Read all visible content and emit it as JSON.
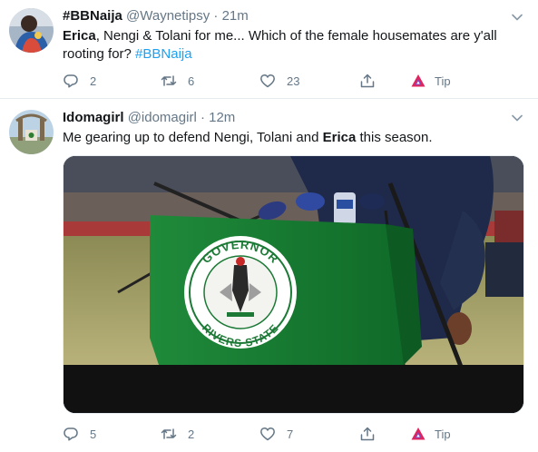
{
  "tweets": [
    {
      "display_name": "#BBNaija",
      "handle": "@Waynetipsy",
      "separator": "·",
      "time": "21m",
      "text_parts": [
        "Erica",
        ", Nengi & Tolani for me... Which of the female housemates are y'all rooting for? ",
        "#BBNaija"
      ],
      "reply_count": "2",
      "retweet_count": "6",
      "like_count": "23",
      "tip_label": "Tip"
    },
    {
      "display_name": "Idomagirl",
      "handle": "@idomagirl",
      "separator": "·",
      "time": "12m",
      "text_parts": [
        "Me gearing up to defend Nengi, Tolani and ",
        "Erica",
        " this season."
      ],
      "media": {
        "seal_top_text": "GOVERNOR",
        "seal_bottom_text": "RIVERS STATE"
      },
      "reply_count": "5",
      "retweet_count": "2",
      "like_count": "7",
      "tip_label": "Tip"
    }
  ],
  "icons": {
    "caret": "chevron-down-icon",
    "reply": "reply-icon",
    "retweet": "retweet-icon",
    "like": "heart-icon",
    "share": "share-icon",
    "tip": "tip-icon"
  },
  "colors": {
    "hashtag": "#1da1f2",
    "meta_text": "#657786",
    "divider": "#e6ecf0",
    "tip_icon_red": "#e0245e",
    "tip_icon_purple": "#794bc4"
  }
}
